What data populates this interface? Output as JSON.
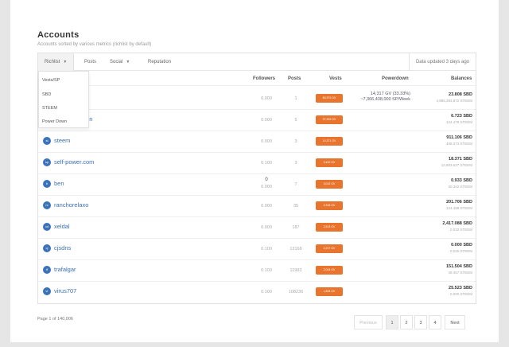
{
  "header": {
    "title": "Accounts",
    "subtitle": "Accounts sorted by various metrics (richlist by default)"
  },
  "tabs": [
    {
      "label": "Richlist",
      "dropdown": true,
      "active": true
    },
    {
      "label": "Posts",
      "dropdown": false
    },
    {
      "label": "Social",
      "dropdown": true
    },
    {
      "label": "Reputation",
      "dropdown": false
    }
  ],
  "updated": "Data updated 3 days ago",
  "dropdown_items": [
    "Vests/SP",
    "SBD",
    "STEEM",
    "Power Down"
  ],
  "columns": [
    "Followers",
    "Posts",
    "Vests",
    "Powerdown",
    "Balances"
  ],
  "rows": [
    {
      "name": "",
      "avatar": "",
      "followers": "0.000",
      "posts": "1",
      "vests": "80,970 GV",
      "powerdown": [
        "14,317 GV (33.33%)",
        "~7,366,438,000 SP/Week"
      ],
      "sbd": "23.808 SBD",
      "steem": "4,885,393,872 STEEM"
    },
    {
      "name": "elegation",
      "avatar": "",
      "followers": "0.000",
      "posts": "5",
      "vests": "37,909 GV",
      "powerdown": [
        "",
        ""
      ],
      "sbd": "6.723 SBD",
      "steem": "124.478 STEEM"
    },
    {
      "name": "steem",
      "avatar": "st",
      "followers": "0.000",
      "posts": "3",
      "vests": "14,371 GV",
      "powerdown": [
        "",
        ""
      ],
      "sbd": "911.106 SBD",
      "steem": "408.373 STEEM"
    },
    {
      "name": "self-power.com",
      "avatar": "sp",
      "followers": "0.100",
      "posts": "3",
      "vests": "3,400 GV",
      "powerdown": [
        "",
        ""
      ],
      "sbd": "18.371 SBD",
      "steem": "12,803.537 STEEM"
    },
    {
      "name": "ben",
      "avatar": "b",
      "followers": "0",
      "followers_sub": "0.000",
      "posts": "7",
      "vests": "3,012 GV",
      "powerdown": [
        "",
        ""
      ],
      "sbd": "0.933 SBD",
      "steem": "30.342 STEEM"
    },
    {
      "name": "ranchorelaxo",
      "avatar": "rx",
      "followers": "0.000",
      "posts": "35",
      "vests": "2,918 GV",
      "powerdown": [
        "",
        ""
      ],
      "sbd": "201.706 SBD",
      "steem": "124.498 STEEM"
    },
    {
      "name": "xeldal",
      "avatar": "xd",
      "followers": "0.000",
      "posts": "187",
      "vests": "2,513 GV",
      "powerdown": [
        "",
        ""
      ],
      "sbd": "2,417.088 SBD",
      "steem": "0.032 STEEM"
    },
    {
      "name": "cjsdns",
      "avatar": "cj",
      "followers": "0.100",
      "posts": "13168",
      "vests": "2,207 GV",
      "powerdown": [
        "",
        ""
      ],
      "sbd": "0.000 SBD",
      "steem": "0.025 STEEM"
    },
    {
      "name": "trafalgar",
      "avatar": "tf",
      "followers": "0.100",
      "posts": "11993",
      "vests": "2,004 GV",
      "powerdown": [
        "",
        ""
      ],
      "sbd": "151.504 SBD",
      "steem": "49.457 STEEM"
    },
    {
      "name": "virus707",
      "avatar": "vr",
      "followers": "0.100",
      "posts": "108236",
      "vests": "1,806 GV",
      "powerdown": [
        "",
        ""
      ],
      "sbd": "25.523 SBD",
      "steem": "0.000 STEEM"
    }
  ],
  "footer": {
    "page_info": "Page 1 of 140,006",
    "previous": "Previous",
    "pages": [
      "1",
      "2",
      "3",
      "4"
    ],
    "next": "Next"
  },
  "colors": {
    "vests_badge": "#e8742d",
    "avatar": "#3b72b8",
    "link": "#3a6fb5"
  }
}
